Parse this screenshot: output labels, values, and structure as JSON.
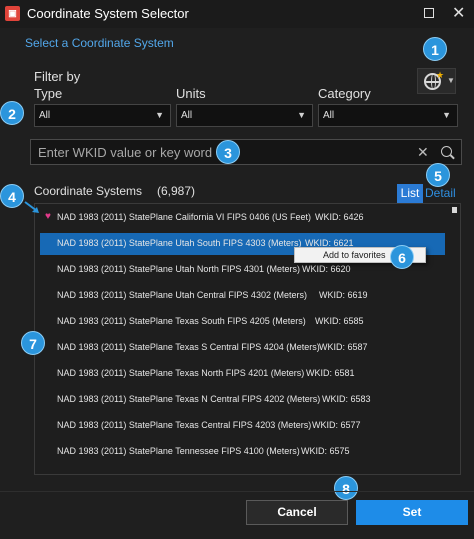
{
  "window": {
    "title": "Coordinate System Selector",
    "app_icon_glyph": "▣"
  },
  "section_title": "Select a Coordinate System",
  "filter": {
    "label": "Filter by",
    "type": {
      "label": "Type",
      "value": "All"
    },
    "units": {
      "label": "Units",
      "value": "All"
    },
    "category": {
      "label": "Category",
      "value": "All"
    }
  },
  "search": {
    "placeholder": "Enter WKID value or key word",
    "clear_glyph": "✕"
  },
  "list_header": {
    "label": "Coordinate Systems",
    "count": "(6,987)",
    "view_list": "List",
    "view_detail": "Detail"
  },
  "rows": [
    {
      "name": "NAD 1983 (2011) StatePlane California VI FIPS 0406 (US Feet)",
      "wkid": "WKID: 6426",
      "favorite": true,
      "selected": false
    },
    {
      "name": "NAD 1983 (2011) StatePlane Utah South FIPS 4303 (Meters)",
      "wkid": "WKID: 6621",
      "favorite": false,
      "selected": true
    },
    {
      "name": "NAD 1983 (2011) StatePlane Utah North FIPS 4301 (Meters)",
      "wkid": "WKID: 6620",
      "favorite": false,
      "selected": false
    },
    {
      "name": "NAD 1983 (2011) StatePlane Utah Central FIPS 4302 (Meters)",
      "wkid": "WKID: 6619",
      "favorite": false,
      "selected": false
    },
    {
      "name": "NAD 1983 (2011) StatePlane Texas South FIPS 4205 (Meters)",
      "wkid": "WKID: 6585",
      "favorite": false,
      "selected": false
    },
    {
      "name": "NAD 1983 (2011) StatePlane Texas S Central FIPS 4204 (Meters)",
      "wkid": "WKID: 6587",
      "favorite": false,
      "selected": false
    },
    {
      "name": "NAD 1983 (2011) StatePlane Texas North FIPS 4201 (Meters)",
      "wkid": "WKID: 6581",
      "favorite": false,
      "selected": false
    },
    {
      "name": "NAD 1983 (2011) StatePlane Texas N Central FIPS 4202 (Meters)",
      "wkid": "WKID: 6583",
      "favorite": false,
      "selected": false
    },
    {
      "name": "NAD 1983 (2011) StatePlane Texas Central FIPS 4203 (Meters)",
      "wkid": "WKID: 6577",
      "favorite": false,
      "selected": false
    },
    {
      "name": "NAD 1983 (2011) StatePlane Tennessee FIPS 4100 (Meters)",
      "wkid": "WKID: 6575",
      "favorite": false,
      "selected": false
    }
  ],
  "context_menu": {
    "item": "Add to favorites"
  },
  "callouts": [
    "1",
    "2",
    "3",
    "4",
    "5",
    "6",
    "7",
    "8"
  ],
  "buttons": {
    "cancel": "Cancel",
    "set": "Set"
  },
  "colors": {
    "accent": "#2b95dc",
    "selected_row": "#1769b5",
    "set_button": "#1e8ce8",
    "favorite_heart": "#e23a8a"
  },
  "icons": {
    "app": "app-icon",
    "globe": "globe-icon",
    "clear": "clear-icon",
    "search": "search-icon",
    "favorite": "heart-icon"
  }
}
